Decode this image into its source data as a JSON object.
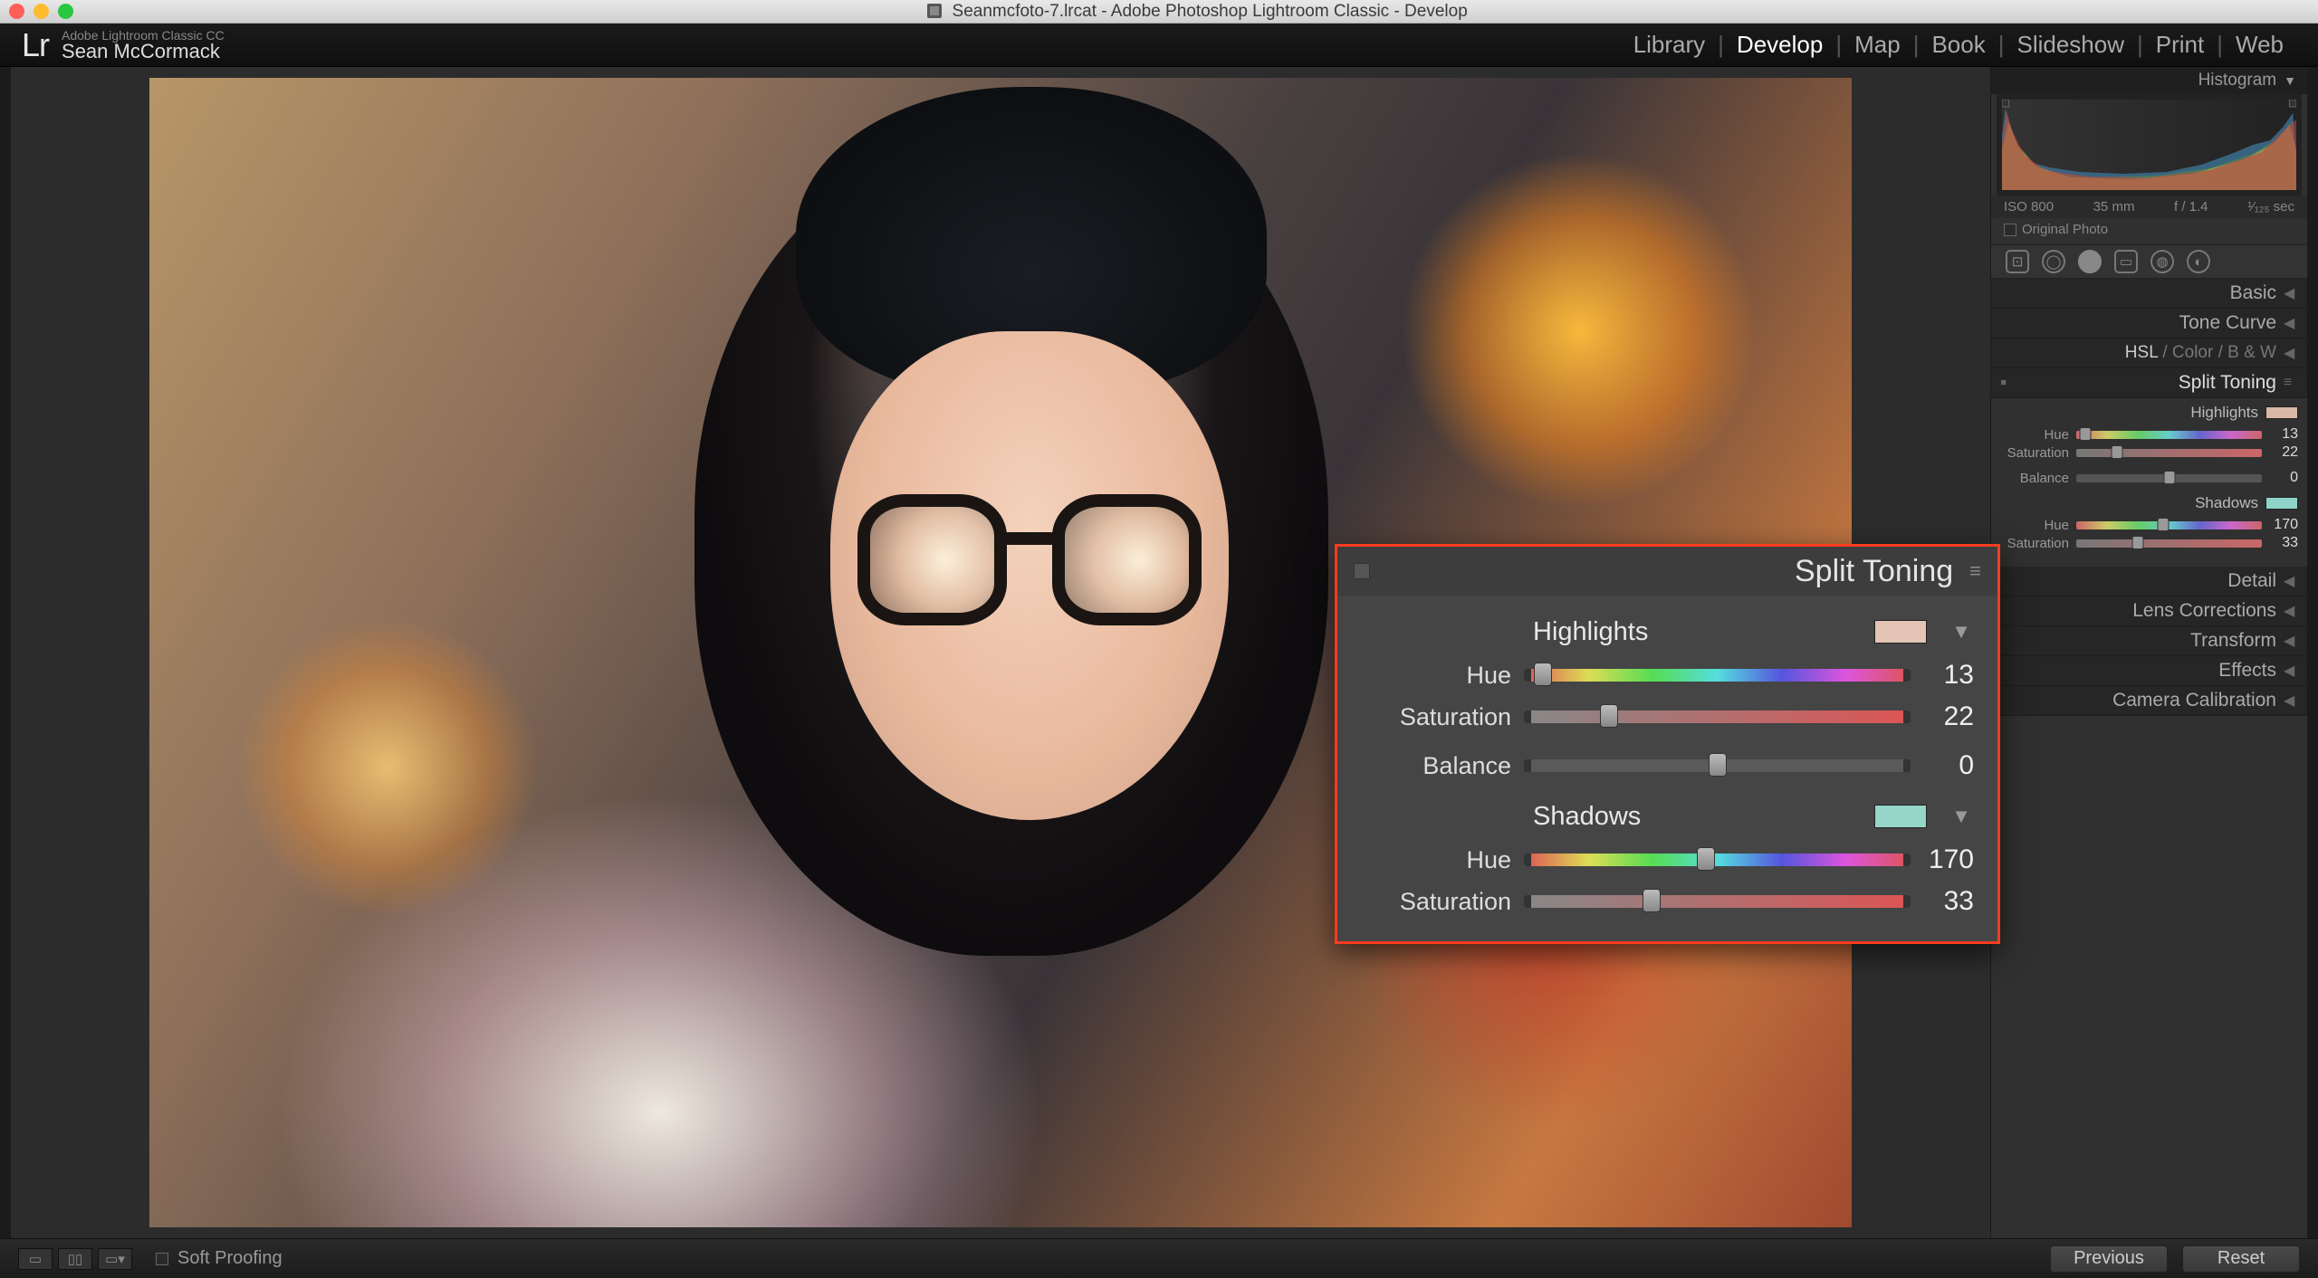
{
  "chrome": {
    "title": "Seanmcfoto-7.lrcat - Adobe Photoshop Lightroom Classic - Develop"
  },
  "header": {
    "app_line": "Adobe Lightroom Classic CC",
    "user": "Sean McCormack",
    "modules": [
      "Library",
      "Develop",
      "Map",
      "Book",
      "Slideshow",
      "Print",
      "Web"
    ],
    "active_module": "Develop"
  },
  "histogram": {
    "title": "Histogram",
    "iso": "ISO 800",
    "focal": "35 mm",
    "aperture": "f / 1.4",
    "shutter": "¹⁄₁₂₅ sec",
    "original_label": "Original Photo"
  },
  "panels": {
    "basic": "Basic",
    "tone_curve": "Tone Curve",
    "hsl": "HSL",
    "color": "Color",
    "bw": "B & W",
    "split_toning": "Split Toning",
    "detail": "Detail",
    "lens": "Lens Corrections",
    "transform": "Transform",
    "effects": "Effects",
    "calib": "Camera Calibration"
  },
  "split": {
    "highlights_label": "Highlights",
    "shadows_label": "Shadows",
    "hue_label": "Hue",
    "sat_label": "Saturation",
    "bal_label": "Balance",
    "highlights": {
      "hue": 13,
      "sat": 22
    },
    "balance": 0,
    "shadows": {
      "hue": 170,
      "sat": 33
    },
    "swatch_highlights": "#e3c4b5",
    "swatch_shadows": "#96d6c9"
  },
  "footer": {
    "soft_proof": "Soft Proofing",
    "previous": "Previous",
    "reset": "Reset"
  }
}
